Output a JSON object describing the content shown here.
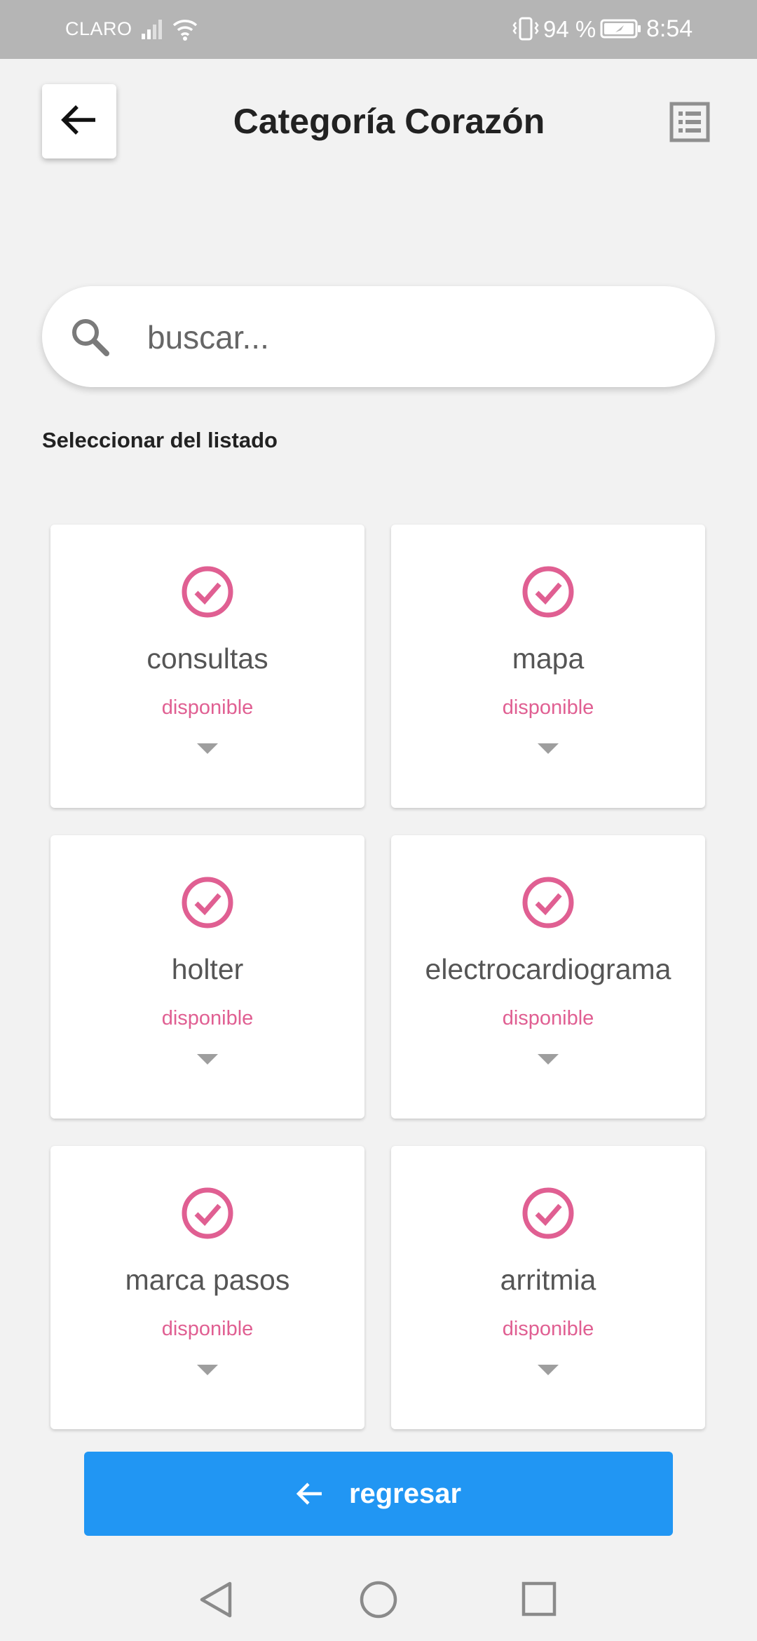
{
  "status_bar": {
    "carrier": "CLARO",
    "battery": "94 %",
    "time": "8:54",
    "icons": [
      "signal-icon",
      "wifi-icon",
      "vibrate-icon",
      "battery-icon"
    ]
  },
  "header": {
    "title": "Categoría Corazón",
    "back_icon": "arrow-left-icon",
    "list_icon": "list-icon"
  },
  "search": {
    "placeholder": "buscar...",
    "value": "",
    "icon": "search-icon"
  },
  "section_label": "Seleccionar del listado",
  "cards": [
    {
      "name": "consultas",
      "status": "disponible"
    },
    {
      "name": "mapa",
      "status": "disponible"
    },
    {
      "name": "holter",
      "status": "disponible"
    },
    {
      "name": "electrocardiograma",
      "status": "disponible"
    },
    {
      "name": "marca pasos",
      "status": "disponible"
    },
    {
      "name": "arritmia",
      "status": "disponible"
    }
  ],
  "footer": {
    "return_label": "regresar",
    "return_icon": "arrow-left-icon"
  },
  "colors": {
    "accent": "#e05f92",
    "button": "#2196f3",
    "background": "#f2f2f2",
    "status_bar": "#b5b5b5"
  },
  "nav_bar": [
    "nav-back-icon",
    "nav-home-icon",
    "nav-recent-icon"
  ]
}
